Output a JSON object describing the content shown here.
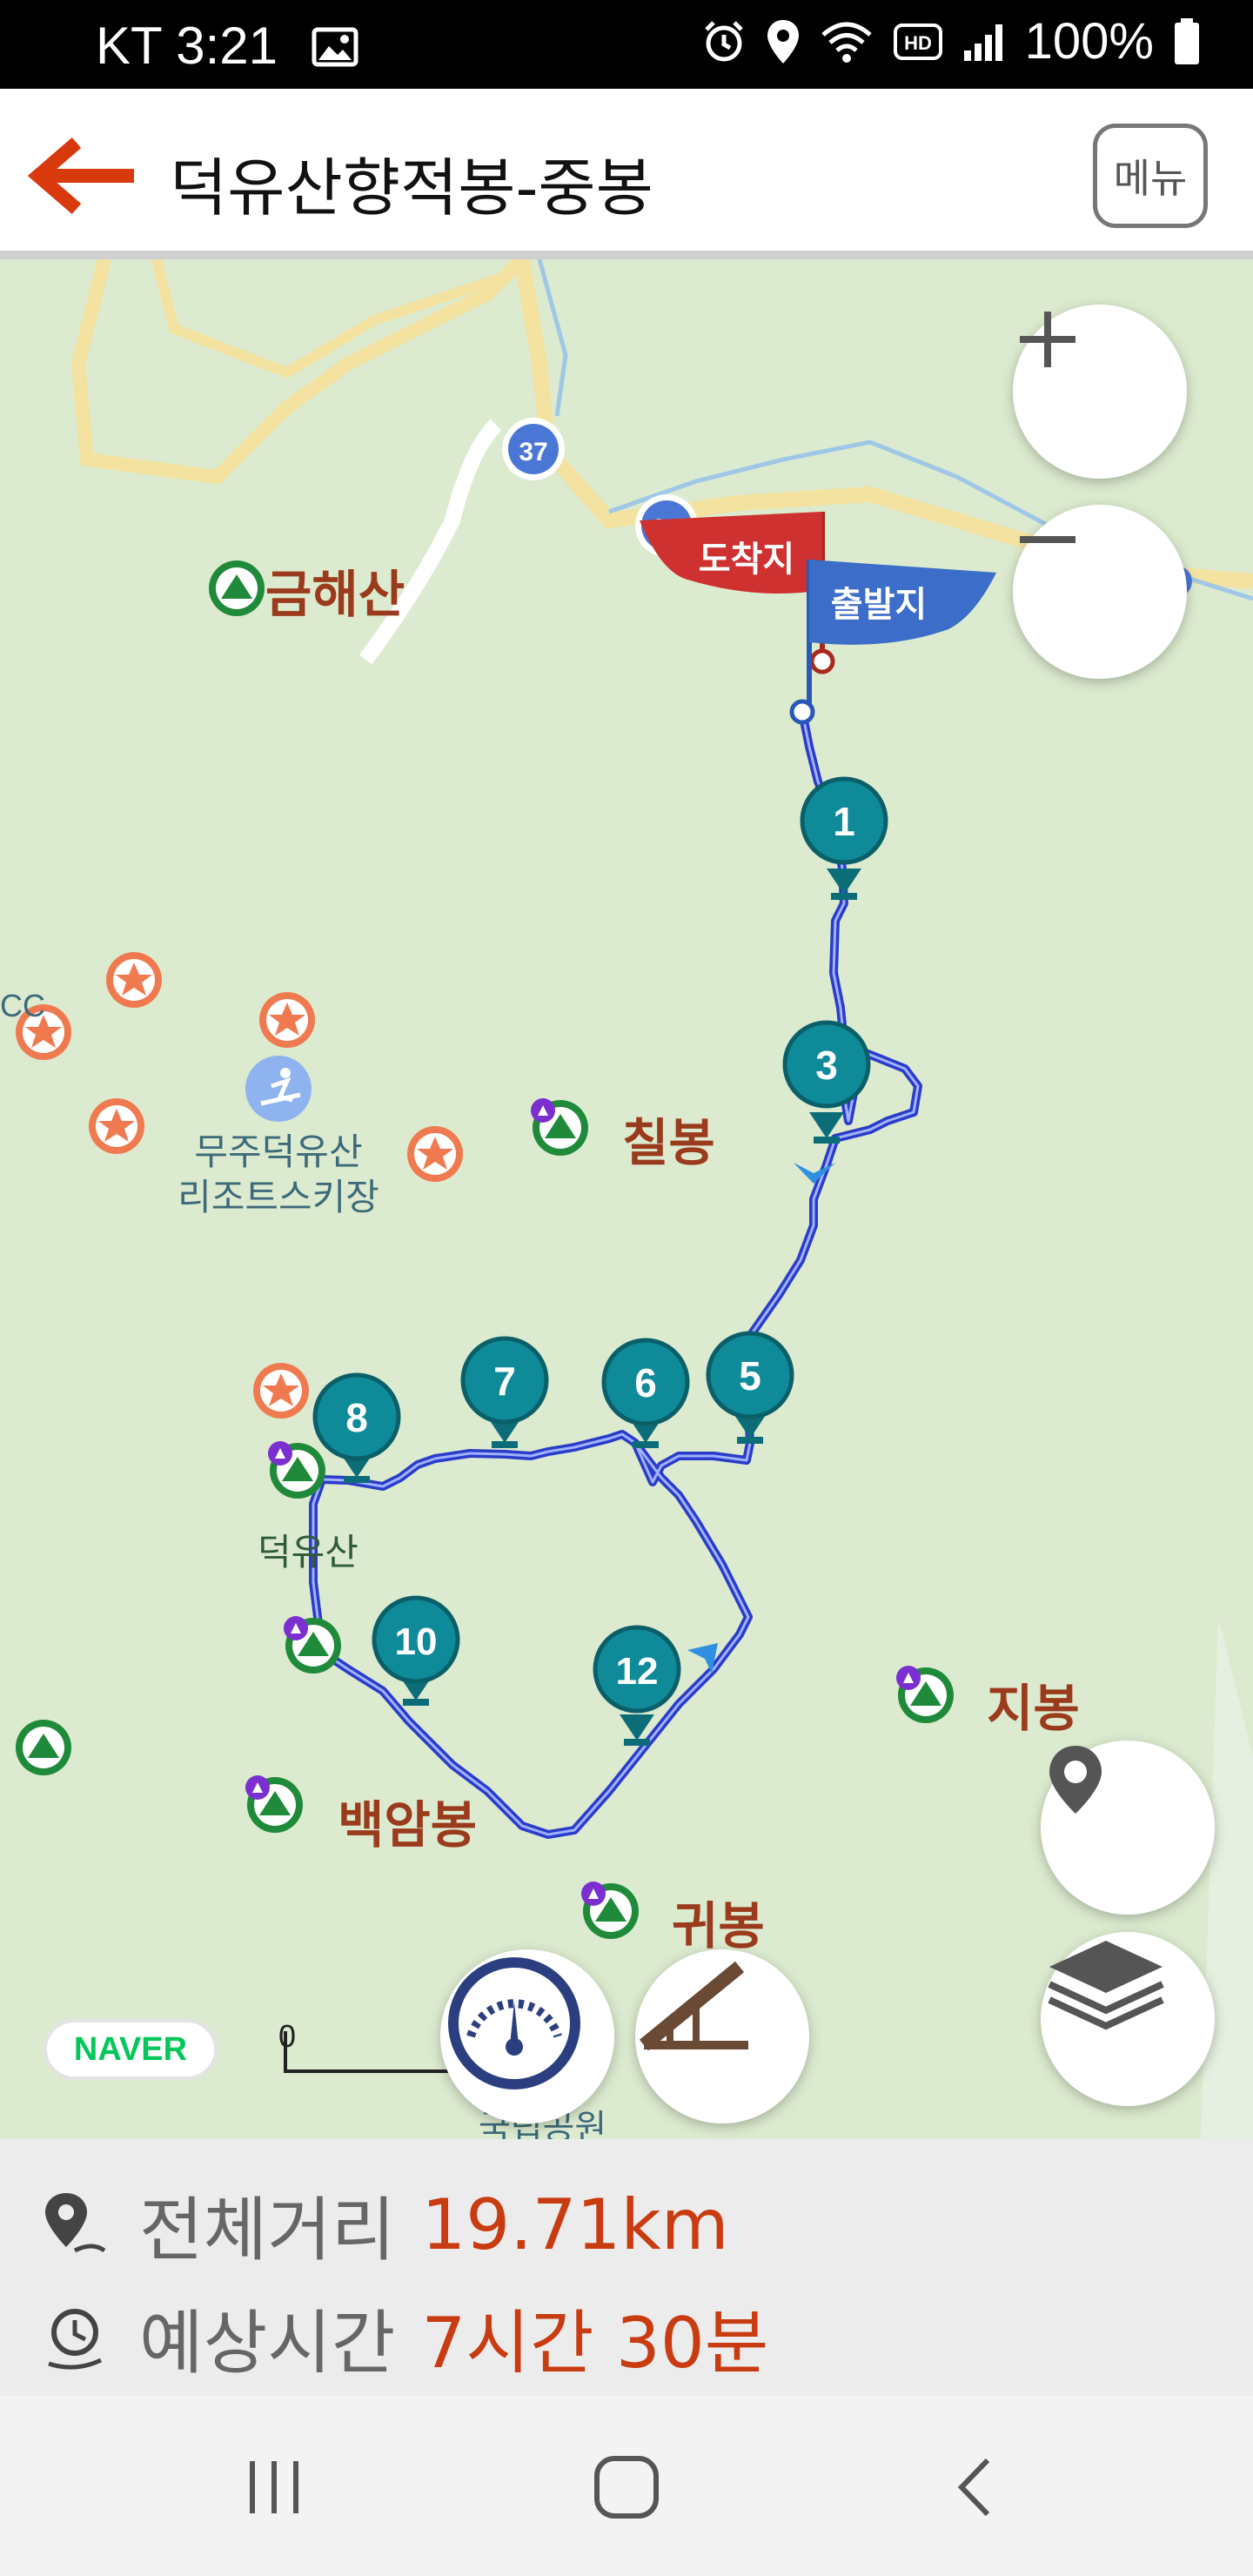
{
  "status_bar": {
    "left": "KT 3:21",
    "battery": "100%"
  },
  "header": {
    "title": "덕유산향적봉-중봉",
    "menu_label": "메뉴"
  },
  "map": {
    "places": {
      "geumhaesan": "금해산",
      "chilbong": "칠봉",
      "deogyusan": "덕유산",
      "baegambong": "백암봉",
      "jibong": "지봉",
      "gwibong": "귀봉",
      "resort": "무주덕유산\n리조트스키장"
    },
    "flags": {
      "arrival": "도착지",
      "departure": "출발지"
    },
    "road_shields": [
      "37",
      "37"
    ],
    "waypoints": [
      "1",
      "3",
      "5",
      "6",
      "7",
      "8",
      "10",
      "12"
    ],
    "scale_zero": "0",
    "partial_labels": {
      "cc": "CC",
      "park": "국립공원"
    },
    "naver_logo": "NAVER"
  },
  "summary": {
    "distance_label": "전체거리",
    "distance_value": "19.71km",
    "time_label": "예상시간",
    "time_value": "7시간 30분"
  },
  "colors": {
    "accent": "#c93b10",
    "route": "#2a3cc9",
    "marker": "#0f8a99",
    "map_bg": "#dcebcf"
  }
}
